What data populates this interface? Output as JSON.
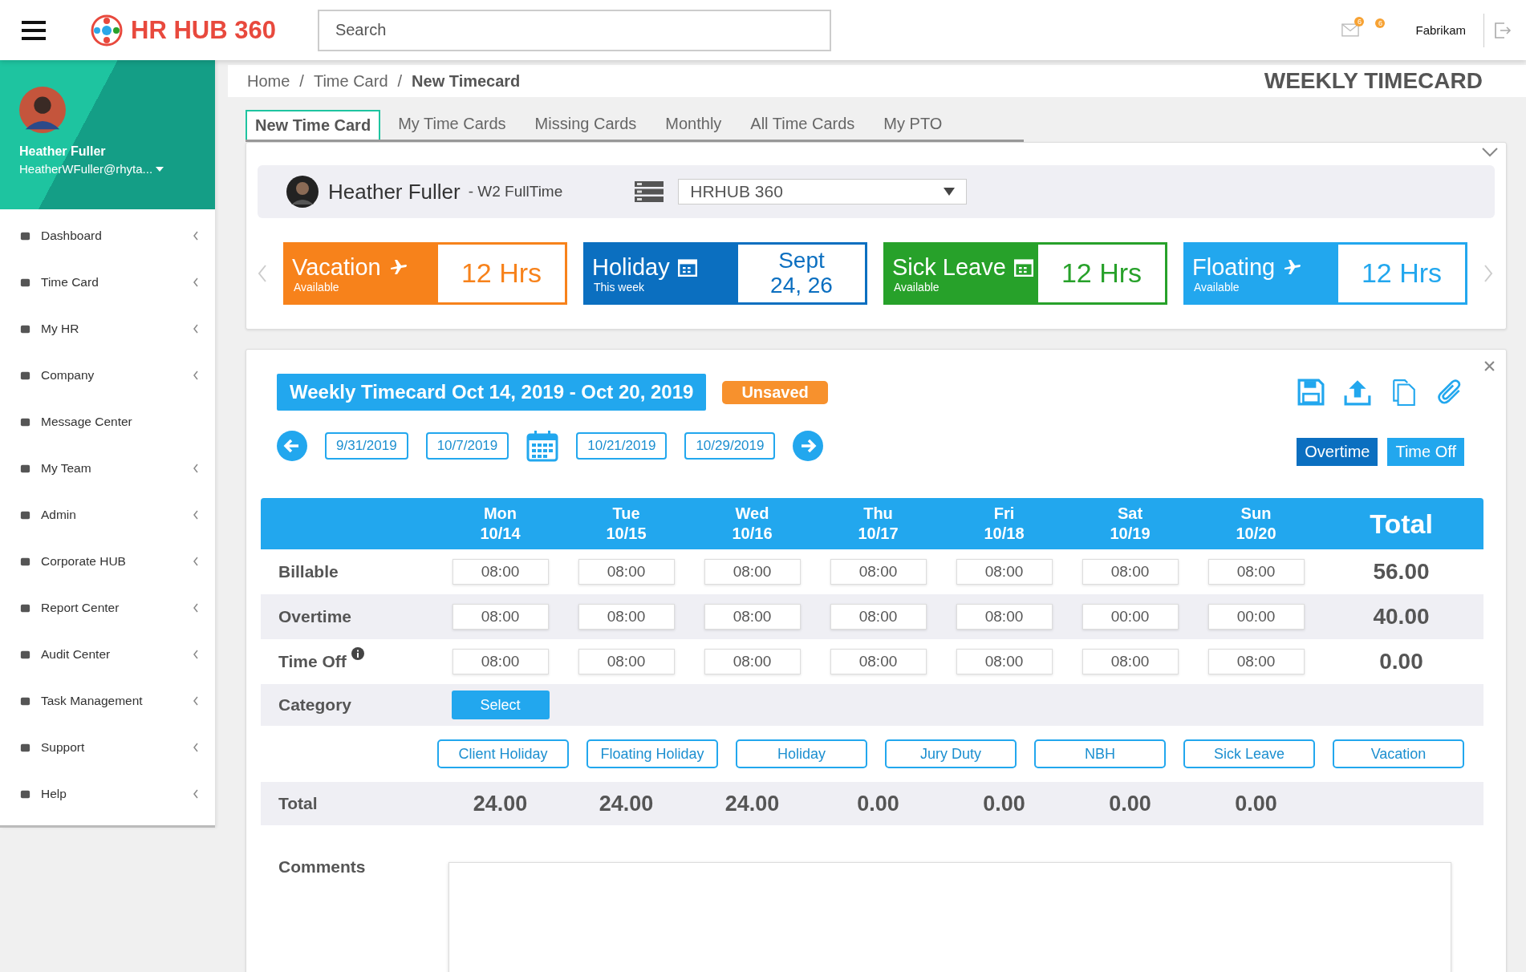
{
  "header": {
    "app_name": "HR HUB 360",
    "search": {
      "placeholder": "Search"
    },
    "mail_badge": "6",
    "alert_badge": "6",
    "company": "Fabrikam"
  },
  "sidebar": {
    "profile": {
      "name": "Heather Fuller",
      "email": "HeatherWFuller@rhyta..."
    },
    "items": [
      {
        "label": "Dashboard",
        "has_submenu": true
      },
      {
        "label": "Time Card",
        "has_submenu": true
      },
      {
        "label": "My HR",
        "has_submenu": true
      },
      {
        "label": "Company",
        "has_submenu": true
      },
      {
        "label": "Message Center",
        "has_submenu": false
      },
      {
        "label": "My Team",
        "has_submenu": true
      },
      {
        "label": "Admin",
        "has_submenu": true
      },
      {
        "label": "Corporate HUB",
        "has_submenu": true
      },
      {
        "label": "Report Center",
        "has_submenu": true
      },
      {
        "label": "Audit Center",
        "has_submenu": true
      },
      {
        "label": "Task Management",
        "has_submenu": true
      },
      {
        "label": "Support",
        "has_submenu": true
      },
      {
        "label": "Help",
        "has_submenu": true
      }
    ]
  },
  "breadcrumb": [
    "Home",
    "Time Card",
    "New Timecard"
  ],
  "breadcrumb_separator": "/",
  "page_title": "WEEKLY TIMECARD",
  "tabs": [
    {
      "label": "New Time Card",
      "selected": true
    },
    {
      "label": "My Time Cards",
      "selected": false
    },
    {
      "label": "Missing Cards",
      "selected": false
    },
    {
      "label": "Monthly",
      "selected": false
    },
    {
      "label": "All Time Cards",
      "selected": false
    },
    {
      "label": "My PTO",
      "selected": false
    }
  ],
  "employee": {
    "name": "Heather Fuller",
    "type": "- W2 FullTime",
    "company_select": {
      "value": "HRHUB 360"
    }
  },
  "balances": [
    {
      "label": "Vacation",
      "sub": "Available",
      "value_lines": [
        "12 Hrs"
      ],
      "color": "#f7821b"
    },
    {
      "label": "Holiday",
      "sub": "This week",
      "value_lines": [
        "Sept",
        "24, 26"
      ],
      "color": "#0b6fc0"
    },
    {
      "label": "Sick Leave",
      "sub": "Available",
      "value_lines": [
        "12 Hrs"
      ],
      "color": "#27a12a"
    },
    {
      "label": "Floating",
      "sub": "Available",
      "value_lines": [
        "12 Hrs"
      ],
      "color": "#22a7ee"
    }
  ],
  "timecard": {
    "title": "Weekly Timecard Oct 14, 2019 - Oct 20, 2019",
    "status": "Unsaved",
    "weeks": [
      "9/31/2019",
      "10/7/2019",
      "10/21/2019",
      "10/29/2019"
    ],
    "modes": [
      {
        "label": "Overtime",
        "selected": true
      },
      {
        "label": "Time Off",
        "selected": false
      }
    ],
    "days": [
      {
        "day": "Mon",
        "date": "10/14"
      },
      {
        "day": "Tue",
        "date": "10/15"
      },
      {
        "day": "Wed",
        "date": "10/16"
      },
      {
        "day": "Thu",
        "date": "10/17"
      },
      {
        "day": "Fri",
        "date": "10/18"
      },
      {
        "day": "Sat",
        "date": "10/19"
      },
      {
        "day": "Sun",
        "date": "10/20"
      }
    ],
    "total_heading": "Total",
    "rows": [
      {
        "label": "Billable",
        "info": false,
        "values": [
          "08:00",
          "08:00",
          "08:00",
          "08:00",
          "08:00",
          "08:00",
          "08:00"
        ],
        "total": "56.00"
      },
      {
        "label": "Overtime",
        "info": false,
        "values": [
          "08:00",
          "08:00",
          "08:00",
          "08:00",
          "08:00",
          "00:00",
          "00:00"
        ],
        "total": "40.00"
      },
      {
        "label": "Time Off",
        "info": true,
        "values": [
          "08:00",
          "08:00",
          "08:00",
          "08:00",
          "08:00",
          "08:00",
          "08:00"
        ],
        "total": "0.00"
      }
    ],
    "category": {
      "label": "Category",
      "button": "Select"
    },
    "categories": [
      "Client Holiday",
      "Floating Holiday",
      "Holiday",
      "Jury Duty",
      "NBH",
      "Sick Leave",
      "Vacation"
    ],
    "totals": {
      "label": "Total",
      "values": [
        "24.00",
        "24.00",
        "24.00",
        "0.00",
        "0.00",
        "0.00",
        "0.00"
      ]
    },
    "comments_label": "Comments"
  }
}
